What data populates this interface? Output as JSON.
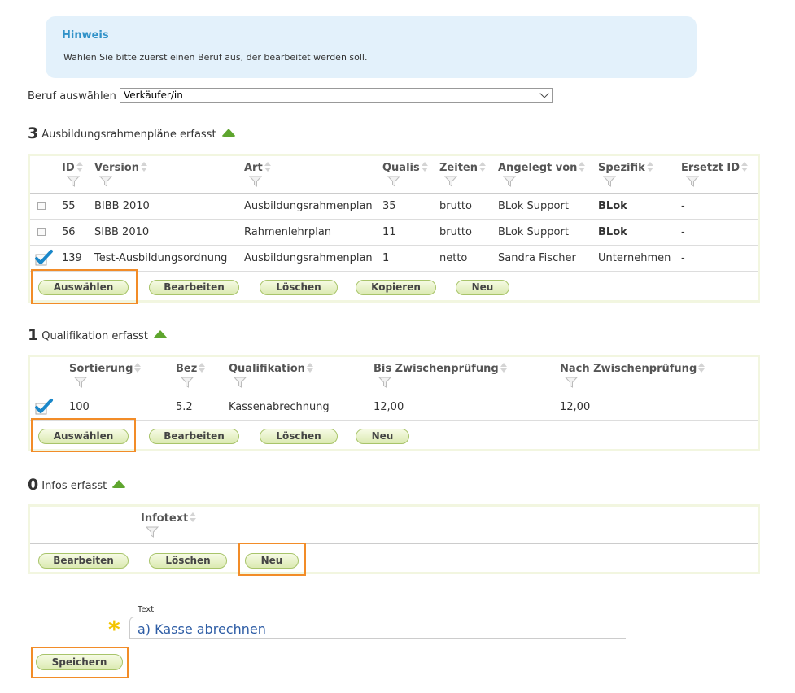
{
  "hint": {
    "title": "Hinweis",
    "text": "Wählen Sie bitte zuerst einen Beruf aus, der bearbeitet werden soll."
  },
  "beruf": {
    "label": "Beruf auswählen",
    "selected": "Verkäufer/in"
  },
  "plans": {
    "count": "3",
    "title": "Ausbildungsrahmenpläne erfasst",
    "columns": [
      "ID",
      "Version",
      "Art",
      "Qualis",
      "Zeiten",
      "Angelegt von",
      "Spezifik",
      "Ersetzt ID"
    ],
    "rows": [
      {
        "checked": false,
        "id": "55",
        "version": "BIBB 2010",
        "art": "Ausbildungsrahmenplan",
        "qualis": "35",
        "zeiten": "brutto",
        "angelegt": "BLok Support",
        "spezifik": "BLok",
        "ersetzt": "-"
      },
      {
        "checked": false,
        "id": "56",
        "version": "SIBB 2010",
        "art": "Rahmenlehrplan",
        "qualis": "11",
        "zeiten": "brutto",
        "angelegt": "BLok Support",
        "spezifik": "BLok",
        "ersetzt": "-"
      },
      {
        "checked": true,
        "id": "139",
        "version": "Test-Ausbildungsordnung",
        "art": "Ausbildungsrahmenplan",
        "qualis": "1",
        "zeiten": "netto",
        "angelegt": "Sandra Fischer",
        "spezifik": "Unternehmen",
        "ersetzt": "-"
      }
    ],
    "buttons": {
      "select": "Auswählen",
      "edit": "Bearbeiten",
      "delete": "Löschen",
      "copy": "Kopieren",
      "new": "Neu"
    }
  },
  "quals": {
    "count": "1",
    "title": "Qualifikation erfasst",
    "columns": [
      "Sortierung",
      "Bez",
      "Qualifikation",
      "Bis Zwischenprüfung",
      "Nach Zwischenprüfung"
    ],
    "rows": [
      {
        "checked": true,
        "sort": "100",
        "bez": "5.2",
        "qual": "Kassenabrechnung",
        "bis": "12,00",
        "nach": "12,00"
      }
    ],
    "buttons": {
      "select": "Auswählen",
      "edit": "Bearbeiten",
      "delete": "Löschen",
      "new": "Neu"
    }
  },
  "infos": {
    "count": "0",
    "title": "Infos erfasst",
    "columns": [
      "Infotext"
    ],
    "buttons": {
      "edit": "Bearbeiten",
      "delete": "Löschen",
      "new": "Neu"
    }
  },
  "text_field": {
    "label": "Text",
    "value": "a) Kasse abrechnen",
    "required_mark": "*"
  },
  "save_button": "Speichern",
  "colors": {
    "accent_green": "#5ea52e",
    "highlight_orange": "#f28c28",
    "hint_bg": "#e3f1fb",
    "hint_title": "#3192c8",
    "text_blue": "#2e5da5"
  }
}
